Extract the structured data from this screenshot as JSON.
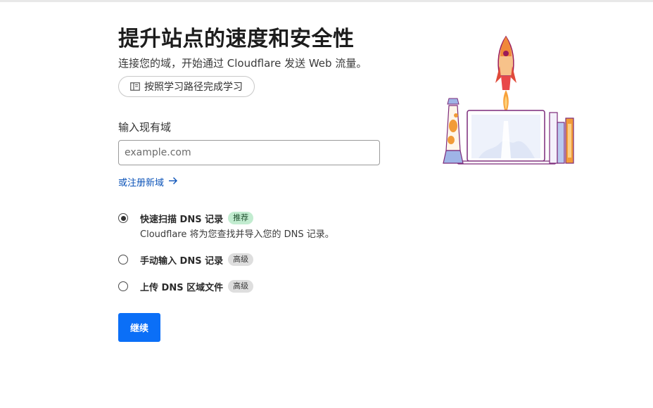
{
  "header": {
    "title": "提升站点的速度和安全性",
    "subtitle": "连接您的域，开始通过 Cloudflare 发送 Web 流量。",
    "learn_button": "按照学习路径完成学习"
  },
  "form": {
    "domain_label": "输入现有域",
    "domain_placeholder": "example.com",
    "domain_value": "",
    "register_link": "或注册新域"
  },
  "options": [
    {
      "title": "快速扫描 DNS 记录",
      "badge": "推荐",
      "description": "Cloudflare 将为您查找并导入您的 DNS 记录。",
      "selected": true
    },
    {
      "title": "手动输入 DNS 记录",
      "badge": "高级",
      "selected": false
    },
    {
      "title": "上传 DNS 区域文件",
      "badge": "高级",
      "selected": false
    }
  ],
  "actions": {
    "continue_label": "继续"
  },
  "colors": {
    "primary": "#0b6ff7",
    "link": "#0a52b8",
    "badge_green": "#c2ecd0",
    "badge_gray": "#dedede"
  },
  "icons": {
    "learn": "book-icon",
    "register_link": "arrow-right-icon",
    "illustration": "rocket-laptop-illustration"
  }
}
